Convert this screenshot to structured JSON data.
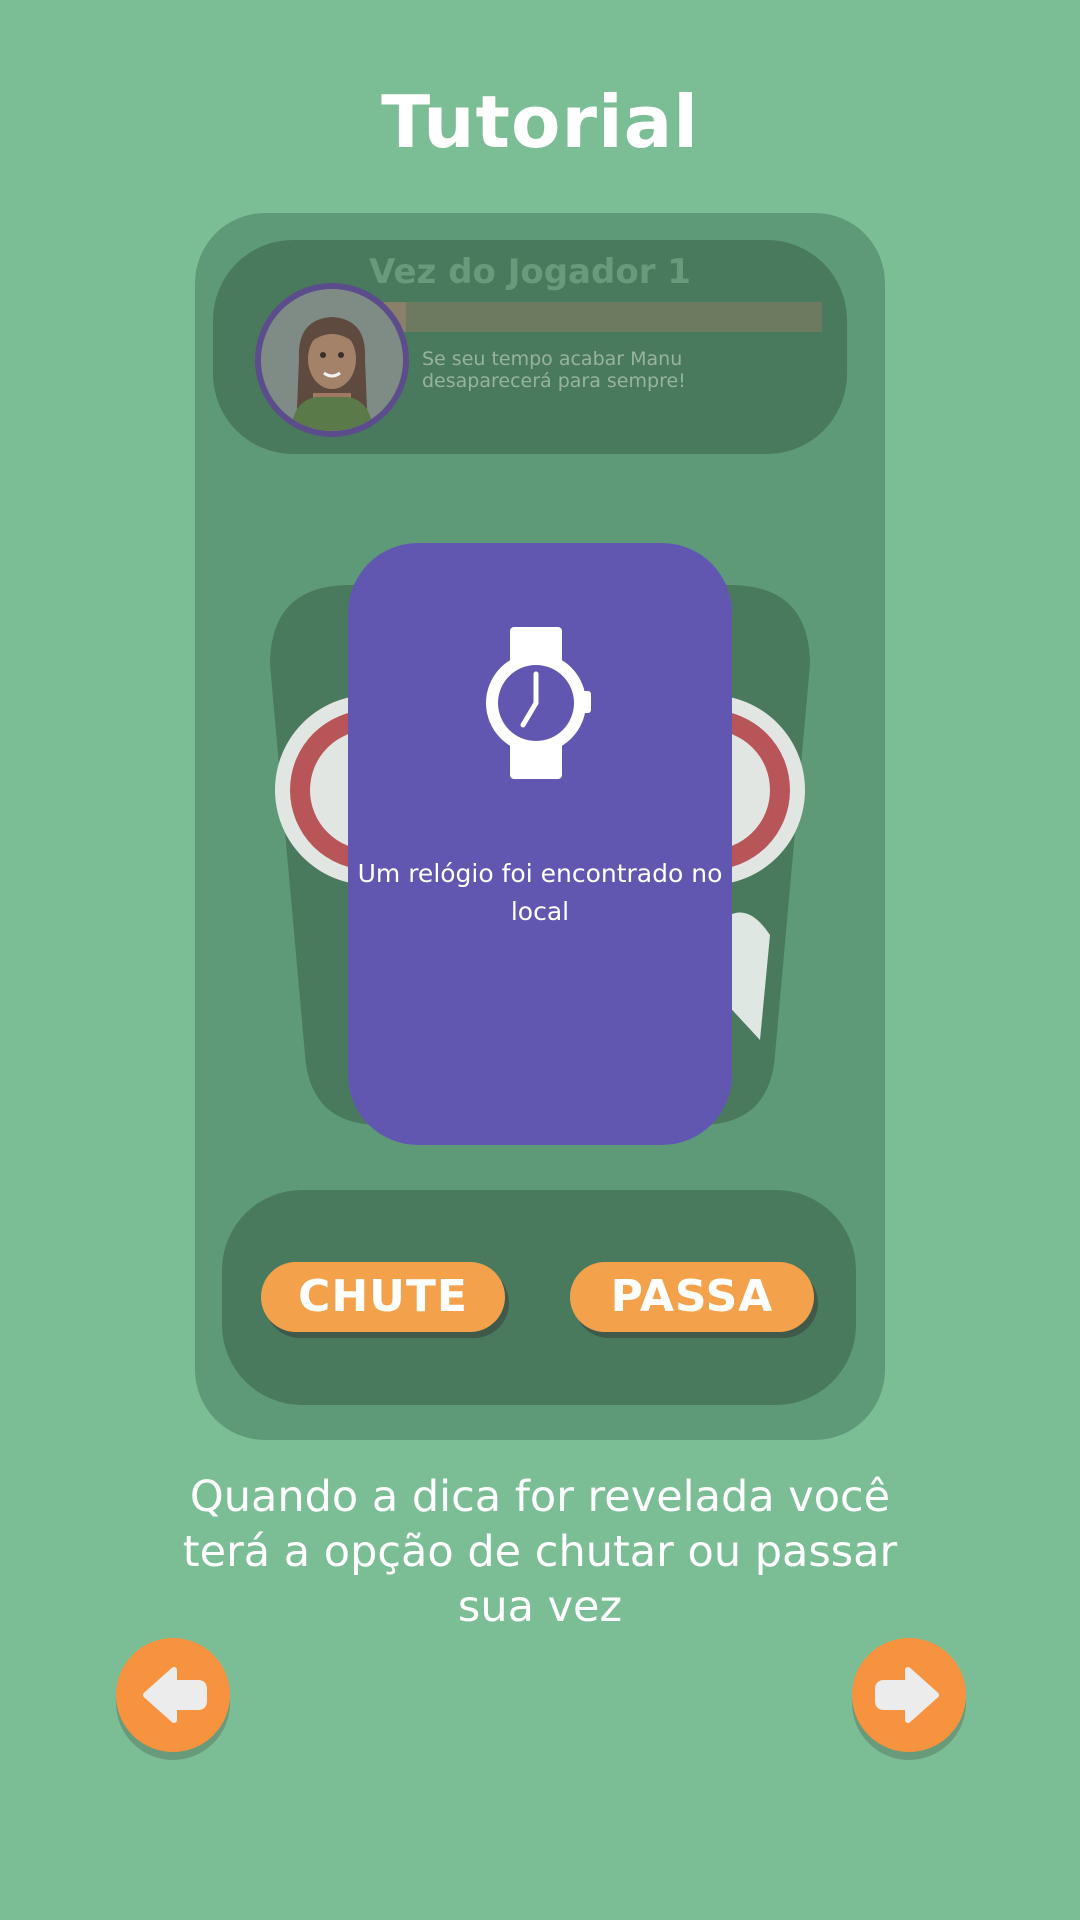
{
  "page": {
    "title": "Tutorial",
    "description": "Quando a dica for revelada você terá a opção de chutar ou passar sua vez"
  },
  "game_preview": {
    "header": {
      "player_turn": "Vez do Jogador 1",
      "warning": "Se seu tempo acabar Manu desaparecerá para sempre!",
      "timer_progress": 0.1
    },
    "clue_card": {
      "icon": "watch-icon",
      "text": "Um relógio foi encontrado no local"
    },
    "actions": {
      "guess_label": "CHUTE",
      "pass_label": "PASSA"
    }
  },
  "navigation": {
    "prev_icon": "arrow-left-icon",
    "next_icon": "arrow-right-icon"
  },
  "colors": {
    "background": "#7bbe96",
    "card_purple": "#6257b0",
    "button_orange": "#f3a24b",
    "nav_orange": "#f7933e"
  }
}
